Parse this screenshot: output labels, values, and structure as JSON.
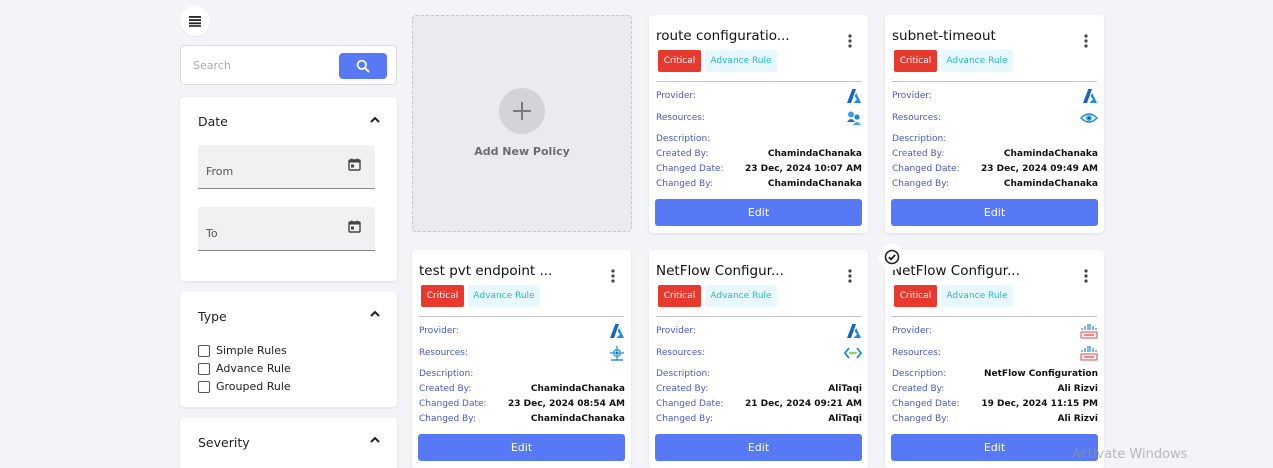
{
  "search": {
    "placeholder": "Search"
  },
  "filters": {
    "date": {
      "title": "Date",
      "from_label": "From",
      "to_label": "To"
    },
    "type": {
      "title": "Type",
      "options": [
        "Simple Rules",
        "Advance Rule",
        "Grouped Rule"
      ]
    },
    "severity": {
      "title": "Severity"
    }
  },
  "add_policy": {
    "label": "Add New Policy"
  },
  "labels": {
    "provider": "Provider:",
    "resources": "Resources:",
    "description": "Description:",
    "created_by": "Created By:",
    "changed_date": "Changed Date:",
    "changed_by": "Changed By:",
    "edit": "Edit"
  },
  "cards": [
    {
      "title": "route configuratio...",
      "severity": "Critical",
      "rule_type": "Advance Rule",
      "provider_icon": "azure-icon",
      "resource_icon": "azure-users-icon",
      "description": "",
      "created_by": "ChamindaChanaka",
      "changed_date": "23 Dec, 2024 10:07 AM",
      "changed_by": "ChamindaChanaka"
    },
    {
      "title": "subnet-timeout",
      "severity": "Critical",
      "rule_type": "Advance Rule",
      "provider_icon": "azure-icon",
      "resource_icon": "azure-network-watcher-icon",
      "description": "",
      "created_by": "ChamindaChanaka",
      "changed_date": "23 Dec, 2024 09:49 AM",
      "changed_by": "ChamindaChanaka"
    },
    {
      "title": "test pvt endpoint ...",
      "severity": "Critical",
      "rule_type": "Advance Rule",
      "provider_icon": "azure-icon",
      "resource_icon": "azure-private-endpoint-icon",
      "description": "",
      "created_by": "ChamindaChanaka",
      "changed_date": "23 Dec, 2024 08:54 AM",
      "changed_by": "ChamindaChanaka"
    },
    {
      "title": "NetFlow Configur...",
      "severity": "Critical",
      "rule_type": "Advance Rule",
      "provider_icon": "azure-icon",
      "resource_icon": "azure-vnet-icon",
      "description": "",
      "created_by": "AliTaqi",
      "changed_date": "21 Dec, 2024 09:21 AM",
      "changed_by": "AliTaqi"
    },
    {
      "title": "NetFlow Configur...",
      "severity": "Critical",
      "rule_type": "Advance Rule",
      "provider_icon": "cisco-icon",
      "resource_icon": "cisco-device-icon",
      "description": "NetFlow Configuration",
      "created_by": "Ali Rizvi",
      "changed_date": "19 Dec, 2024 11:15 PM",
      "changed_by": "Ali Rizvi"
    }
  ],
  "colors": {
    "primary": "#5879f6",
    "critical": "#e8392f",
    "advance_rule_bg": "#e6f8fb",
    "advance_rule_text": "#2bb8cf",
    "field_label": "#4a57d6"
  },
  "watermark": "Activate Windows"
}
